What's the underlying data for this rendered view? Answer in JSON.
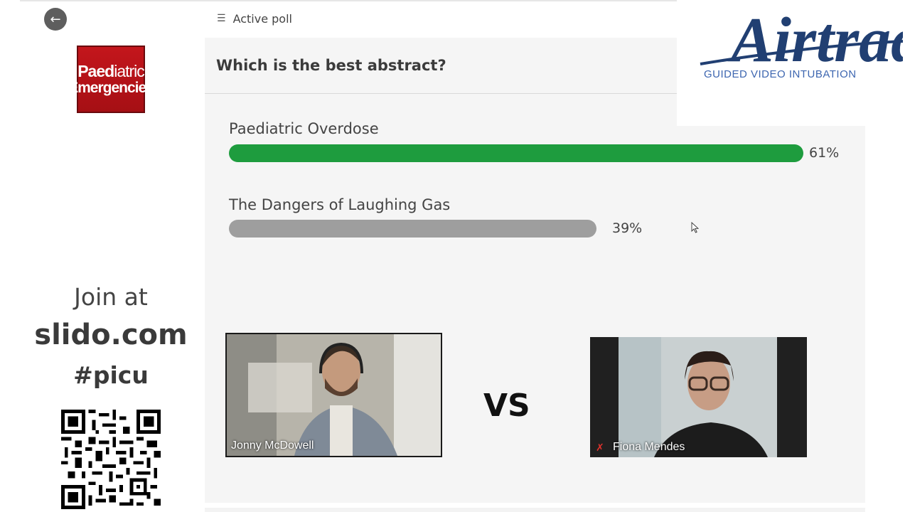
{
  "header": {
    "title": "Active poll"
  },
  "poll": {
    "question": "Which is the best abstract?",
    "options": [
      {
        "label": "Paediatric Overdose",
        "percent_text": "61%",
        "percent": 61,
        "color": "#1e9c3e"
      },
      {
        "label": "The Dangers of Laughing Gas",
        "percent_text": "39%",
        "percent": 39,
        "color": "#9e9e9e"
      }
    ]
  },
  "sidebar": {
    "logo": {
      "line1a": "Paed",
      "line1b": "iatric",
      "line2": "Emergencies"
    },
    "join_at": "Join at",
    "join_url": "slido.com",
    "event_code": "#picu"
  },
  "brand": {
    "name": "Airtraq",
    "tagline": "GUIDED VIDEO INTUBATION",
    "color": "#213f72"
  },
  "videos": [
    {
      "name": "Jonny McDowell"
    },
    {
      "name": "Fiona Mendes"
    }
  ],
  "vs_label": "VS"
}
